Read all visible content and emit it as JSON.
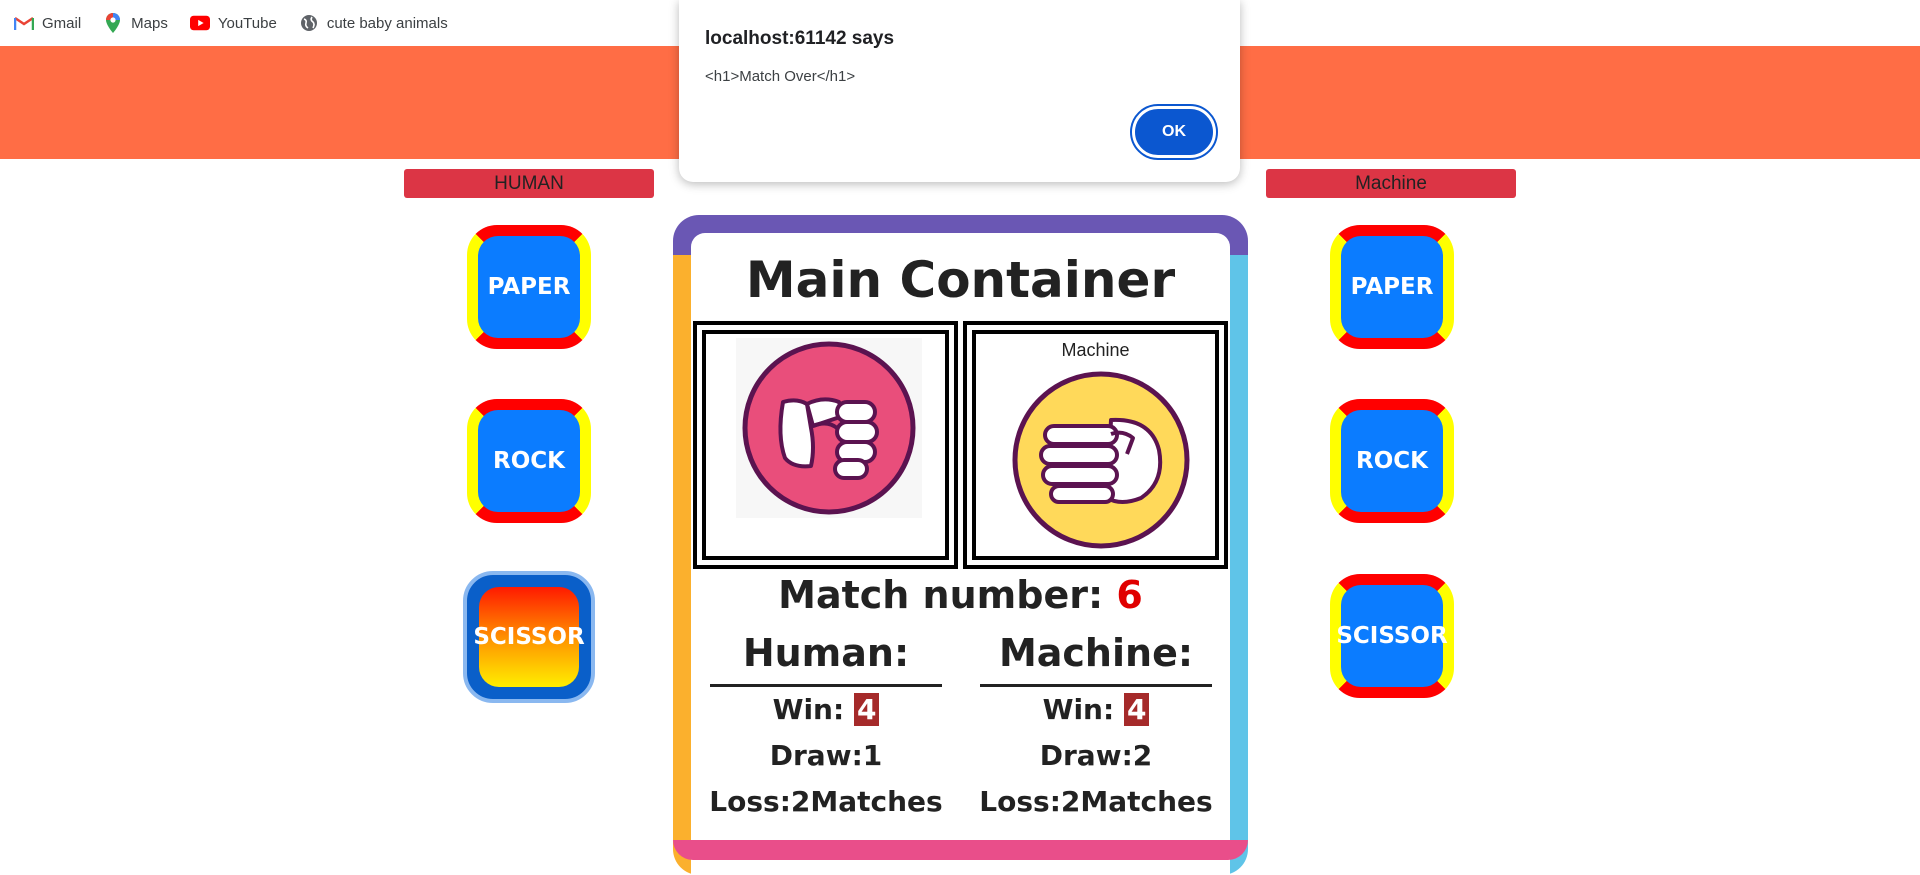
{
  "bookmarks": [
    {
      "label": "Gmail",
      "icon": "gmail-icon"
    },
    {
      "label": "Maps",
      "icon": "maps-pin-icon"
    },
    {
      "label": "YouTube",
      "icon": "youtube-icon"
    },
    {
      "label": "cute baby animals",
      "icon": "globe-icon"
    }
  ],
  "players": {
    "human_label": "HUMAN",
    "machine_label": "Machine"
  },
  "human_choices": [
    "PAPER",
    "ROCK",
    "SCISSOR"
  ],
  "machine_choices": [
    "PAPER",
    "ROCK",
    "SCISSOR"
  ],
  "human_selected": "SCISSOR",
  "main": {
    "title": "Main Container",
    "machine_pane_label": "Machine",
    "human_hand_icon": "rock-fist-icon",
    "machine_hand_icon": "paper-hand-icon",
    "match_label": "Match number:",
    "match_number": "6"
  },
  "scores": {
    "human": {
      "heading": "Human:",
      "win_label": "Win:",
      "win": "4",
      "draw": "Draw:1",
      "loss": "Loss:2Matches"
    },
    "machine": {
      "heading": "Machine:",
      "win_label": "Win:",
      "win": "4",
      "draw": "Draw:2",
      "loss": "Loss:2Matches"
    }
  },
  "dialog": {
    "title": "localhost:61142 says",
    "message": "<h1>Match Over</h1>",
    "ok_label": "OK"
  },
  "colors": {
    "header": "#ff6d45",
    "label_bg": "#dc3545",
    "choice_blue": "#0b7cff",
    "match_number": "#e00000",
    "win_badge": "#a52a2a",
    "dialog_button": "#0b57d0"
  }
}
